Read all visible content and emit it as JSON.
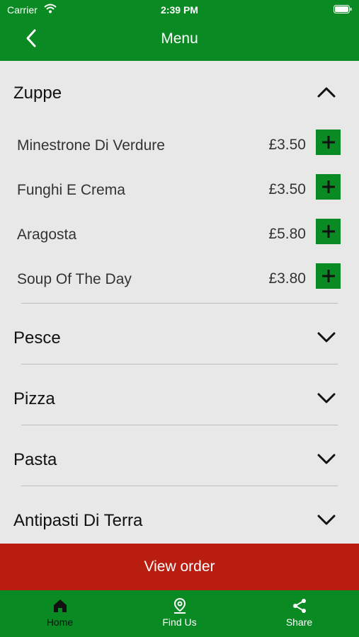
{
  "status_bar": {
    "carrier": "Carrier",
    "time": "2:39 PM"
  },
  "nav": {
    "title": "Menu",
    "back_icon": "chevron-left-icon"
  },
  "categories": [
    {
      "name": "Zuppe",
      "expanded": true,
      "items": [
        {
          "name": "Minestrone Di Verdure",
          "price": "£3.50"
        },
        {
          "name": "Funghi E Crema",
          "price": "£3.50"
        },
        {
          "name": "Aragosta",
          "price": "£5.80"
        },
        {
          "name": "Soup Of The Day",
          "price": "£3.80"
        }
      ]
    },
    {
      "name": "Pesce",
      "expanded": false
    },
    {
      "name": "Pizza",
      "expanded": false
    },
    {
      "name": "Pasta",
      "expanded": false
    },
    {
      "name": "Antipasti Di Terra",
      "expanded": false
    }
  ],
  "view_order_label": "View order",
  "tabs": [
    {
      "label": "Home",
      "icon": "home-icon",
      "active": true
    },
    {
      "label": "Find Us",
      "icon": "map-pin-icon",
      "active": false
    },
    {
      "label": "Share",
      "icon": "share-icon",
      "active": false
    }
  ],
  "colors": {
    "primary_green": "#0a8a22",
    "order_red": "#b81d10",
    "background": "#e8e8e8"
  }
}
